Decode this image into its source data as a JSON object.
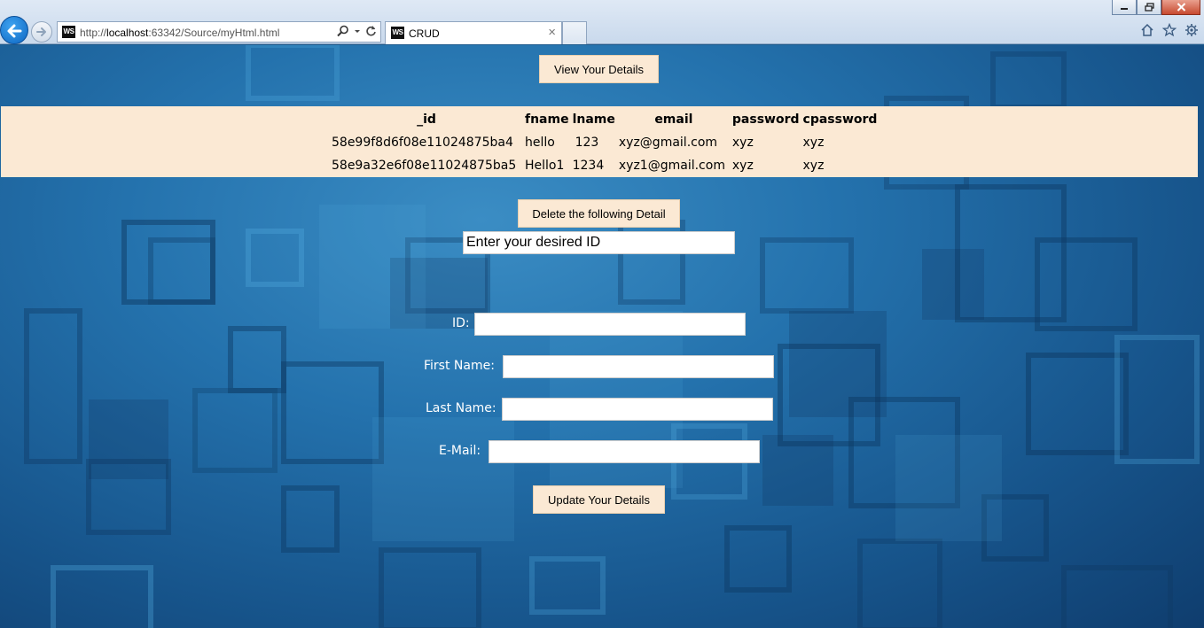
{
  "browser": {
    "url_prefix": "http://",
    "url_host": "localhost",
    "url_rest": ":63342/Source/myHtml.html",
    "favicon": "WS",
    "tab_title": "CRUD",
    "tab_close": "×"
  },
  "view_button": {
    "label": "View Your Details"
  },
  "table": {
    "headers": [
      "_id",
      "fname",
      "lname",
      "email",
      "password",
      "cpassword"
    ],
    "rows": [
      [
        "58e99f8d6f08e11024875ba4",
        "hello",
        "123",
        "xyz@gmail.com",
        "xyz",
        "xyz"
      ],
      [
        "58e9a32e6f08e11024875ba5",
        "Hello1",
        "1234",
        "xyz1@gmail.com",
        "xyz",
        "xyz"
      ]
    ]
  },
  "delete": {
    "button_label": "Delete the following Detail",
    "id_input_value": "Enter your desired ID"
  },
  "form": {
    "id_label": "ID:",
    "first_name_label": "First Name:",
    "last_name_label": "Last Name:",
    "email_label": "E-Mail:",
    "id_value": "",
    "first_name_value": "",
    "last_name_value": "",
    "email_value": "",
    "update_button_label": "Update Your Details"
  },
  "colors": {
    "panel_bg": "#fbe9d4",
    "page_bg": "#1d5a8c"
  },
  "icons": [
    "back-arrow-icon",
    "forward-arrow-icon",
    "search-icon",
    "dropdown-icon",
    "refresh-icon",
    "home-icon",
    "favorites-star-icon",
    "gear-icon",
    "minimize-icon",
    "restore-icon",
    "close-icon"
  ]
}
